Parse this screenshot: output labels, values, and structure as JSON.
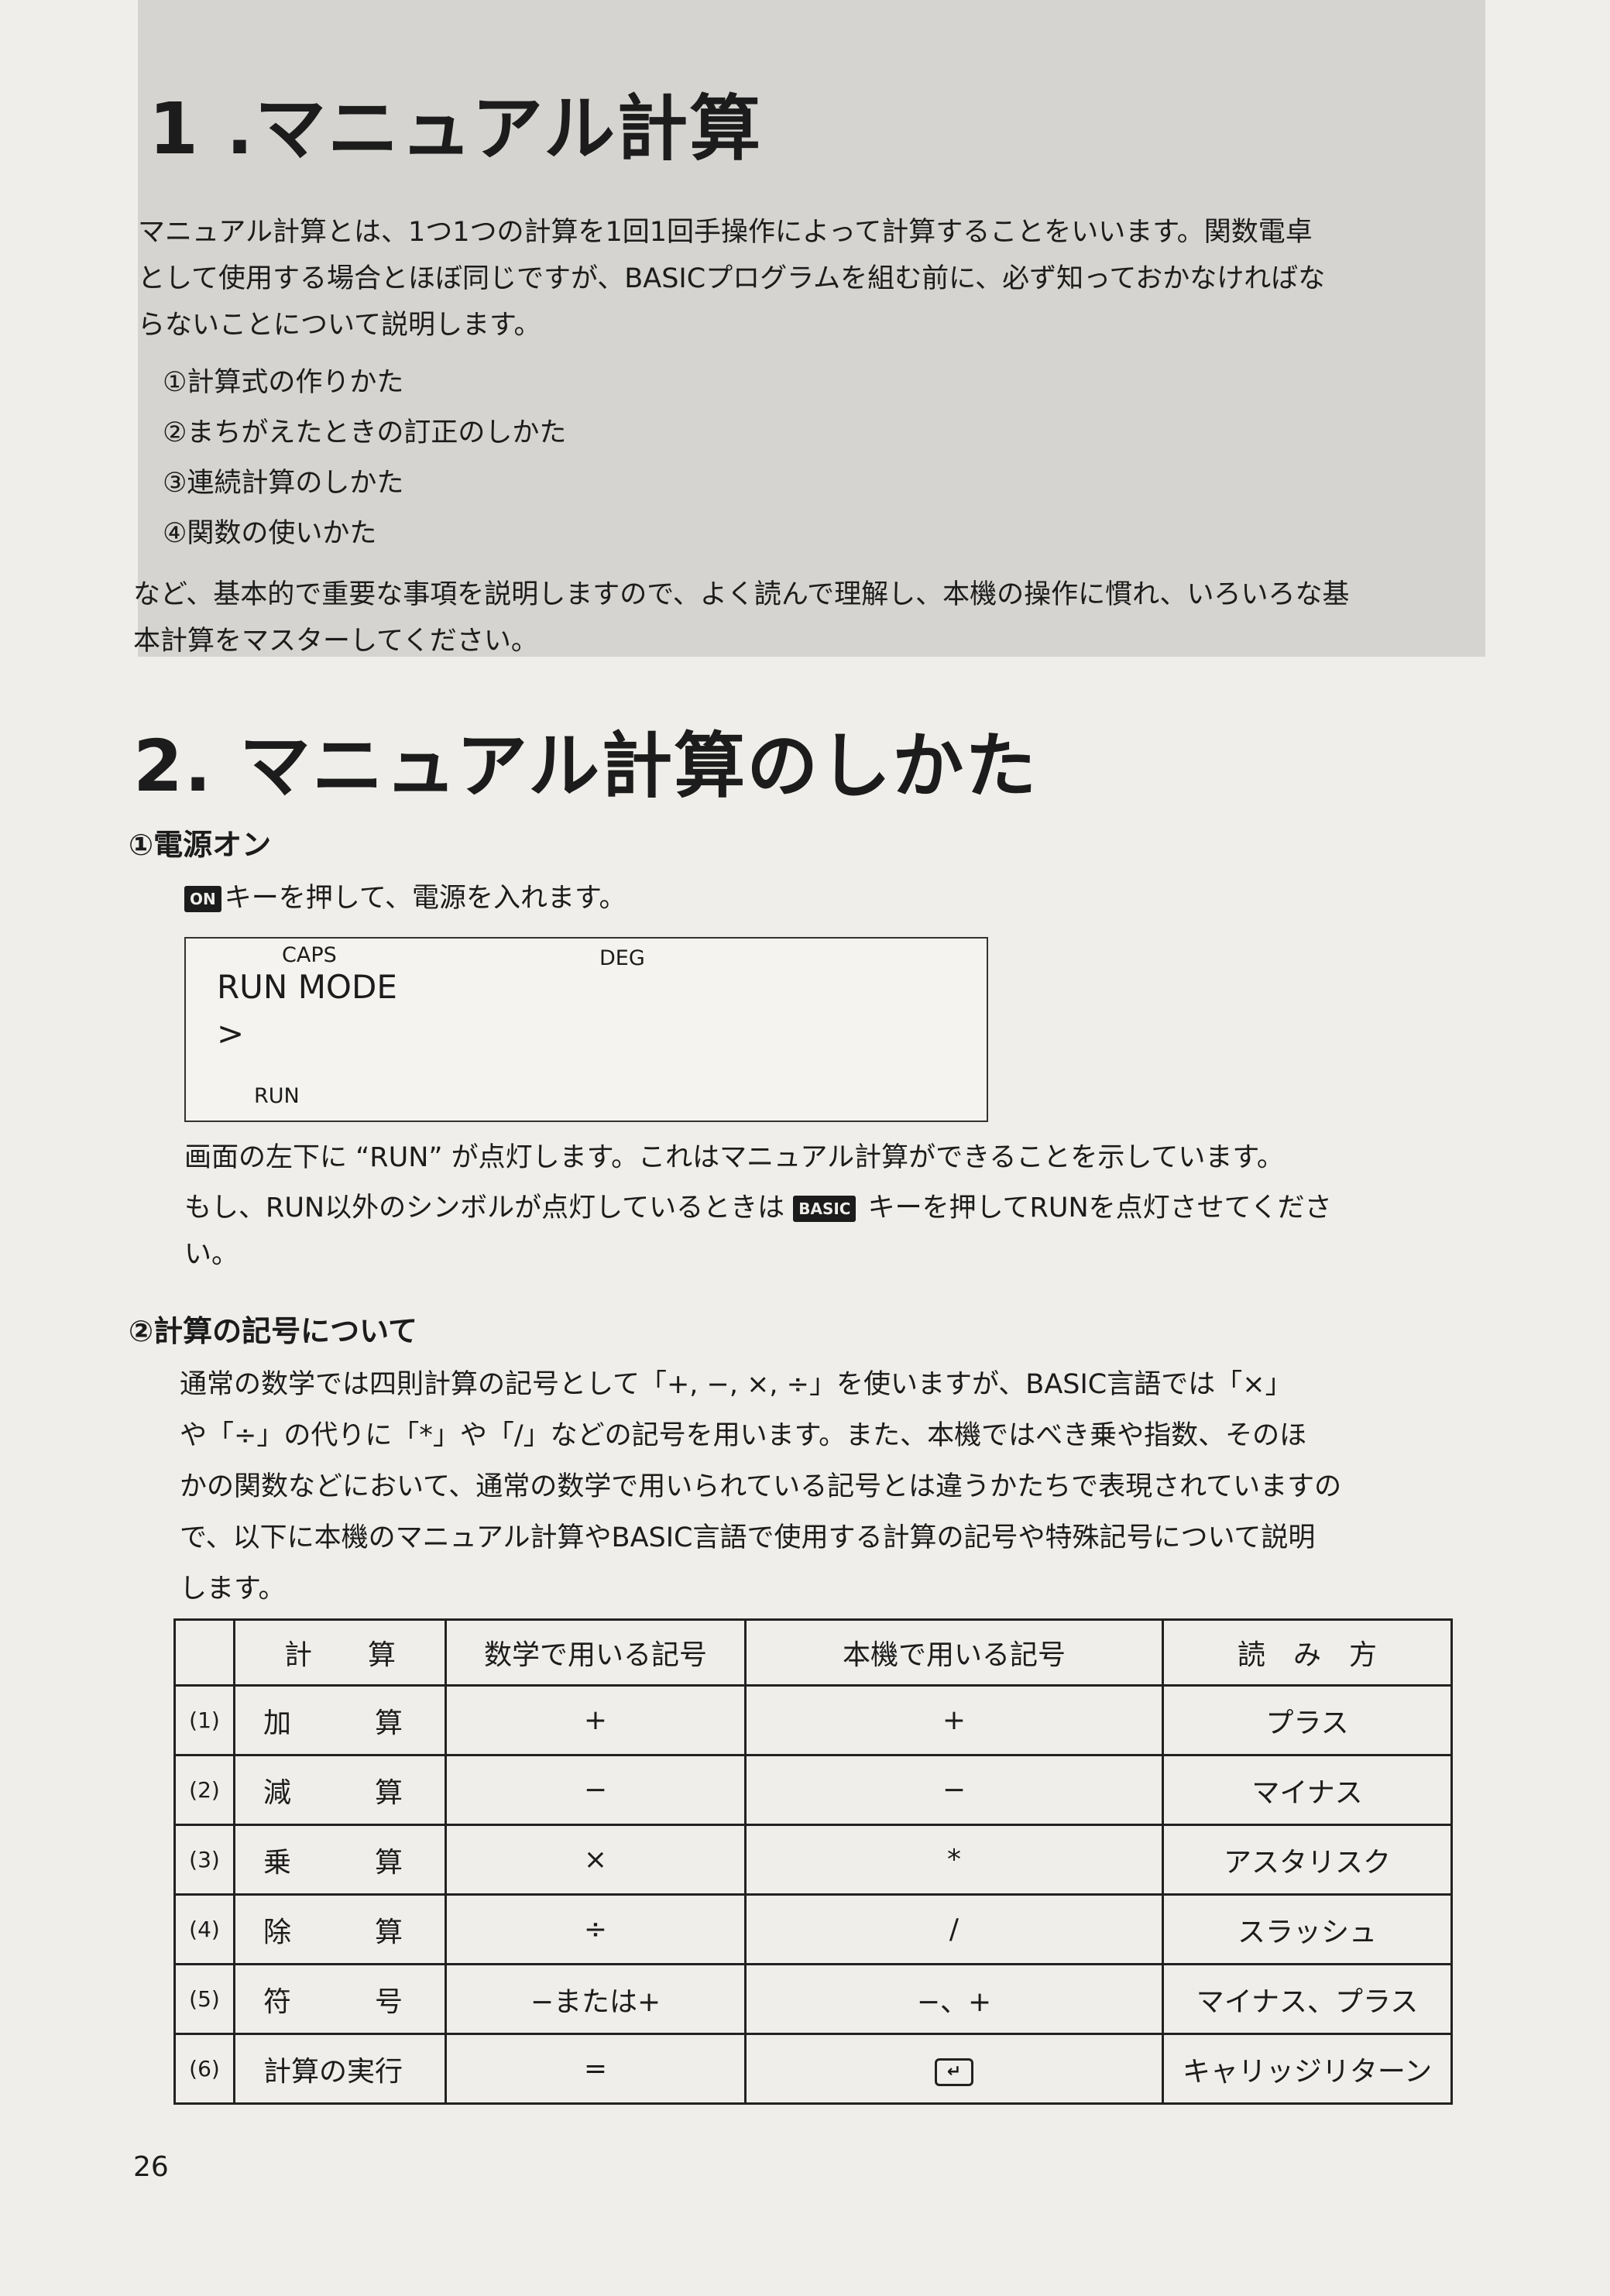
{
  "section1": {
    "title": "1 .マニュアル計算",
    "intro_lines": [
      "マニュアル計算とは、1つ1つの計算を1回1回手操作によって計算することをいいます。関数電卓",
      "として使用する場合とほぼ同じですが、BASICプログラムを組む前に、必ず知っておかなければな",
      "らないことについて説明します。"
    ],
    "list": [
      "①計算式の作りかた",
      "②まちがえたときの訂正のしかた",
      "③連続計算のしかた",
      "④関数の使いかた"
    ],
    "closing_lines": [
      "など、基本的で重要な事項を説明しますので、よく読んで理解し、本機の操作に慣れ、いろいろな基",
      "本計算をマスターしてください。"
    ]
  },
  "section2": {
    "title": "2. マニュアル計算のしかた",
    "sub1": {
      "heading": "①電源オン",
      "key": "ON",
      "instruction": "キーを押して、電源を入れます。",
      "display": {
        "caps": "CAPS",
        "deg": "DEG",
        "mode": "RUN MODE",
        "prompt": ">",
        "run": "RUN"
      },
      "after_line1": "画面の左下に “RUN” が点灯します。これはマニュアル計算ができることを示しています。",
      "after_line2a": "もし、RUN以外のシンボルが点灯しているときは",
      "basic_key": "BASIC",
      "after_line2b": "キーを押してRUNを点灯させてくださ",
      "after_line3": "い。"
    },
    "sub2": {
      "heading": "②計算の記号について",
      "lines": [
        "通常の数学では四則計算の記号として「+, −, ×, ÷」を使いますが、BASIC言語では「×」",
        "や「÷」の代りに「*」や「/」などの記号を用います。また、本機ではべき乗や指数、そのほ",
        "かの関数などにおいて、通常の数学で用いられている記号とは違うかたちで表現されていますの",
        "で、以下に本機のマニュアル計算やBASIC言語で使用する計算の記号や特殊記号について説明",
        "します。"
      ]
    }
  },
  "table": {
    "headers": [
      "",
      "計　　算",
      "数学で用いる記号",
      "本機で用いる記号",
      "読　み　方"
    ],
    "rows": [
      {
        "num": "(1)",
        "calc": "加　　　算",
        "math": "+",
        "machine": "+",
        "reading": "プラス"
      },
      {
        "num": "(2)",
        "calc": "減　　　算",
        "math": "−",
        "machine": "−",
        "reading": "マイナス"
      },
      {
        "num": "(3)",
        "calc": "乗　　　算",
        "math": "×",
        "machine": "*",
        "reading": "アスタリスク"
      },
      {
        "num": "(4)",
        "calc": "除　　　算",
        "math": "÷",
        "machine": "/",
        "reading": "スラッシュ"
      },
      {
        "num": "(5)",
        "calc": "符　　　号",
        "math": "−または+",
        "machine": "−、+",
        "reading": "マイナス、プラス"
      },
      {
        "num": "(6)",
        "calc": "計算の実行",
        "math": "=",
        "machine": "↵",
        "reading": "キャリッジリターン"
      }
    ]
  },
  "page_number": "26"
}
